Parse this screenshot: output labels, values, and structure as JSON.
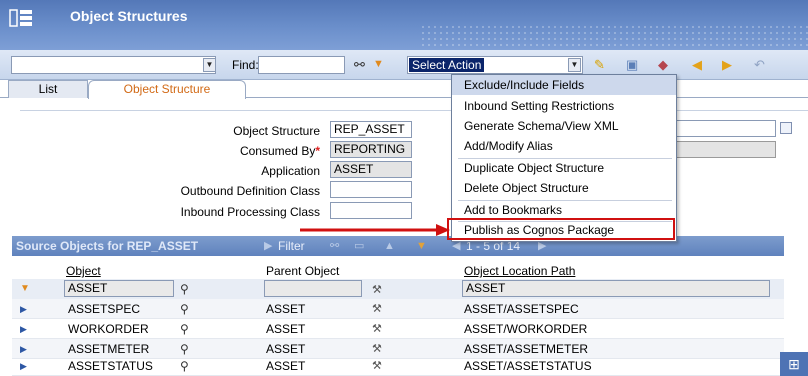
{
  "app": {
    "title": "Object Structures"
  },
  "toolbar": {
    "find_label": "Find:",
    "action_select": "Select Action"
  },
  "tabs": [
    {
      "label": "List"
    },
    {
      "label": "Object Structure"
    }
  ],
  "form": {
    "object_structure_label": "Object Structure",
    "object_structure_value": "REP_ASSET",
    "consumed_by_label": "Consumed By",
    "consumed_by_value": "REPORTING",
    "application_label": "Application",
    "application_value": "ASSET",
    "outbound_label": "Outbound Definition Class",
    "inbound_label": "Inbound Processing Class"
  },
  "table": {
    "title": "Source Objects for REP_ASSET",
    "filter_label": "Filter",
    "count_label": "1 - 5 of 14",
    "columns": [
      "Object",
      "Parent Object",
      "Object Location Path"
    ],
    "filter_values": {
      "object": "ASSET",
      "path": "ASSET"
    },
    "rows": [
      {
        "object": "ASSETSPEC",
        "parent": "ASSET",
        "path": "ASSET/ASSETSPEC"
      },
      {
        "object": "WORKORDER",
        "parent": "ASSET",
        "path": "ASSET/WORKORDER"
      },
      {
        "object": "ASSETMETER",
        "parent": "ASSET",
        "path": "ASSET/ASSETMETER"
      },
      {
        "object": "ASSETSTATUS",
        "parent": "ASSET",
        "path": "ASSET/ASSETSTATUS"
      }
    ]
  },
  "menu": {
    "items": [
      "Exclude/Include Fields",
      "Inbound Setting Restrictions",
      "Generate Schema/View XML",
      "Add/Modify Alias",
      "Duplicate Object Structure",
      "Delete Object Structure",
      "Add to Bookmarks",
      "Publish as Cognos Package"
    ],
    "highlighted_index": 0,
    "callout_index": 7
  },
  "colors": {
    "header": "#5f82bd",
    "callout": "#d01010",
    "active_tab": "#d26a16"
  }
}
